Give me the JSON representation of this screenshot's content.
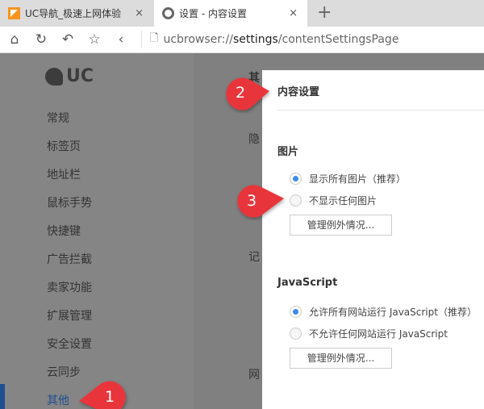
{
  "tabs": [
    {
      "title": "UC导航_极速上网体验",
      "close": "×"
    },
    {
      "title": "设置 - 内容设置",
      "close": "×"
    }
  ],
  "new_tab": "+",
  "toolbar": {
    "url_prefix": "ucbrowser://",
    "url_host": "settings",
    "url_path": "/contentSettingsPage"
  },
  "sidebar": {
    "logo": "UC",
    "items": [
      "常规",
      "标签页",
      "地址栏",
      "鼠标手势",
      "快捷键",
      "广告拦截",
      "卖家功能",
      "扩展管理",
      "安全设置",
      "云同步",
      "其他"
    ],
    "active": "其他"
  },
  "background": {
    "chars": [
      "其",
      "隐",
      "记",
      "网"
    ]
  },
  "dialog": {
    "title": "内容设置",
    "images": {
      "heading": "图片",
      "options": [
        "显示所有图片（推荐）",
        "不显示任何图片"
      ],
      "selected": 0,
      "button": "管理例外情况..."
    },
    "javascript": {
      "heading": "JavaScript",
      "options": [
        "允许所有网站运行 JavaScript（推荐）",
        "不允许任何网站运行 JavaScript"
      ],
      "selected": 0,
      "button": "管理例外情况..."
    }
  },
  "callouts": [
    "1",
    "2",
    "3"
  ],
  "colors": {
    "accent": "#3b8beb",
    "callout": "#e8363a",
    "overlay": "#808080",
    "active_nav": "#1f4f91"
  }
}
